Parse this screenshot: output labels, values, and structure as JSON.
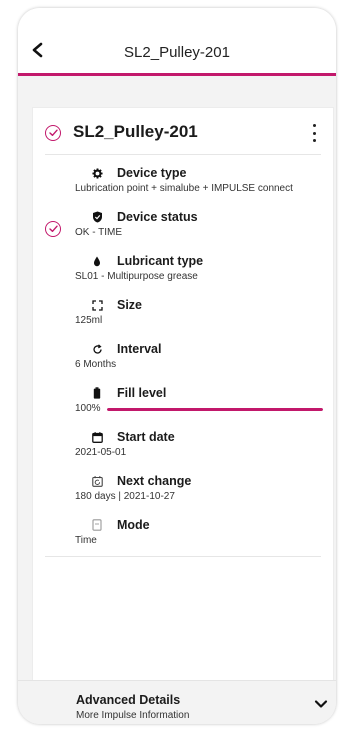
{
  "header": {
    "title": "SL2_Pulley-201",
    "back_icon": "chevron-left-icon"
  },
  "device": {
    "name": "SL2_Pulley-201",
    "menu_icon": "kebab-menu-icon",
    "status_check_icon": "check-circle-icon"
  },
  "details": [
    {
      "key": "device_type",
      "icon": "gear-icon",
      "label": "Device type",
      "value": "Lubrication point + simalube + IMPULSE connect"
    },
    {
      "key": "device_status",
      "icon": "shield-check-icon",
      "label": "Device status",
      "value": "OK - TIME"
    },
    {
      "key": "lubricant_type",
      "icon": "droplet-icon",
      "label": "Lubricant type",
      "value": "SL01 - Multipurpose grease"
    },
    {
      "key": "size",
      "icon": "expand-icon",
      "label": "Size",
      "value": "125ml"
    },
    {
      "key": "interval",
      "icon": "refresh-icon",
      "label": "Interval",
      "value": "6 Months"
    },
    {
      "key": "fill_level",
      "icon": "battery-icon",
      "label": "Fill level",
      "value": "100%",
      "fill_fraction": 1.0
    },
    {
      "key": "start_date",
      "icon": "calendar-icon",
      "label": "Start date",
      "value": "2021-05-01"
    },
    {
      "key": "next_change",
      "icon": "calendar-refresh-icon",
      "label": "Next change",
      "value": "180 days | 2021-10-27"
    },
    {
      "key": "mode",
      "icon": "mode-icon",
      "label": "Mode",
      "value": "Time"
    }
  ],
  "advanced": {
    "title": "Advanced Details",
    "subtitle": "More Impulse Information",
    "chevron_icon": "chevron-down-icon"
  },
  "colors": {
    "accent": "#c2186b",
    "background": "#f3f3f3",
    "card": "#ffffff"
  }
}
